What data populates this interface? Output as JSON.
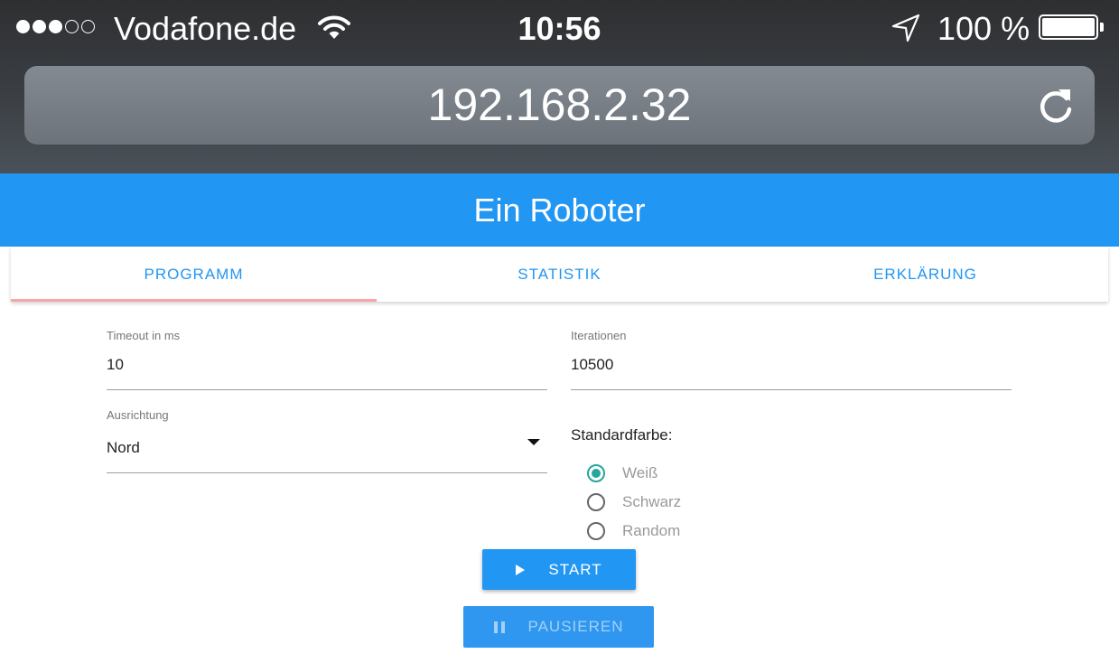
{
  "status_bar": {
    "carrier": "Vodafone.de",
    "signal_bars_filled": 3,
    "signal_bars_total": 5,
    "time": "10:56",
    "battery": "100 %"
  },
  "browser": {
    "url": "192.168.2.32",
    "reload_icon": "reload-icon"
  },
  "app": {
    "title": "Ein Roboter",
    "accent_color": "#2196f3"
  },
  "tabs": [
    {
      "label": "PROGRAMM",
      "active": true
    },
    {
      "label": "STATISTIK",
      "active": false
    },
    {
      "label": "ERKLÄRUNG",
      "active": false
    }
  ],
  "form": {
    "timeout": {
      "label": "Timeout in ms",
      "value": "10"
    },
    "iterations": {
      "label": "Iterationen",
      "value": "10500"
    },
    "orientation": {
      "label": "Ausrichtung",
      "value": "Nord"
    },
    "default_color": {
      "title": "Standardfarbe:",
      "options": [
        {
          "label": "Weiß",
          "checked": true
        },
        {
          "label": "Schwarz",
          "checked": false
        },
        {
          "label": "Random",
          "checked": false
        }
      ],
      "checked_color": "#26a69a"
    }
  },
  "buttons": {
    "start": "START",
    "pause": "PAUSIEREN"
  }
}
